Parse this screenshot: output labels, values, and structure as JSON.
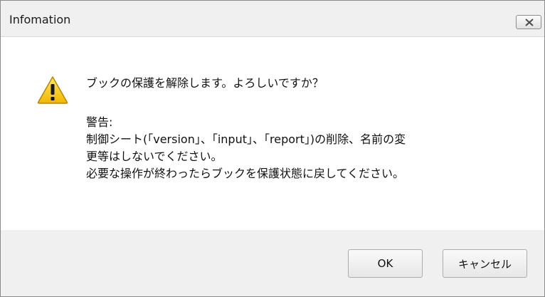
{
  "window": {
    "title": "Infomation",
    "close_icon": "close-icon"
  },
  "message": {
    "icon": "warning-icon",
    "question": "ブックの保護を解除します。よろしいですか？",
    "warning_heading": "警告:",
    "warning_lines": [
      "制御シート(「version」、「input」、「report」)の削除、名前の変",
      "更等はしないでください。",
      "必要な操作が終わったらブックを保護状態に戻してください。"
    ]
  },
  "buttons": {
    "ok_label": "OK",
    "cancel_label": "キャンセル"
  },
  "colors": {
    "warning_yellow": "#f5c400",
    "footer_bg": "#f0f0f0"
  }
}
